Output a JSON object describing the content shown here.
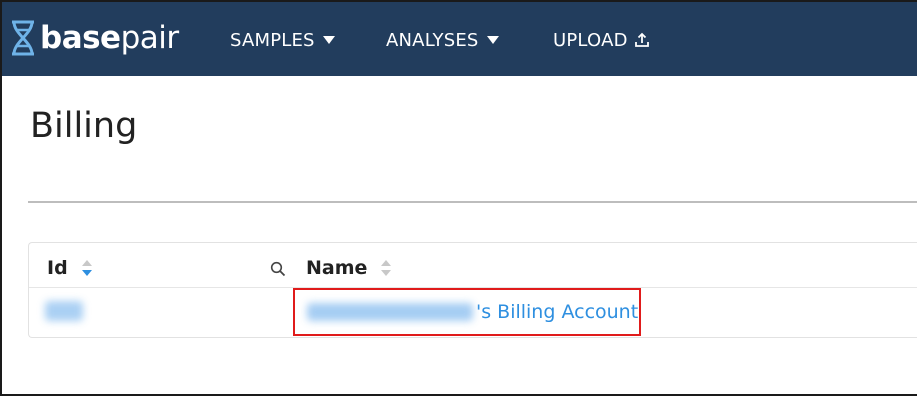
{
  "brand": {
    "bold": "base",
    "light": "pair"
  },
  "nav": {
    "samples": "SAMPLES",
    "analyses": "ANALYSES",
    "upload": "UPLOAD"
  },
  "page": {
    "title": "Billing"
  },
  "table": {
    "headers": {
      "id": "Id",
      "name": "Name"
    },
    "rows": [
      {
        "id": "",
        "name_suffix": "'s Billing Account"
      }
    ]
  },
  "colors": {
    "navbar": "#223d5d",
    "link": "#2e8fe0",
    "highlight": "#e01b1b"
  },
  "icons": {
    "logo": "dna-helix-icon",
    "upload": "upload-icon",
    "search": "search-icon"
  }
}
